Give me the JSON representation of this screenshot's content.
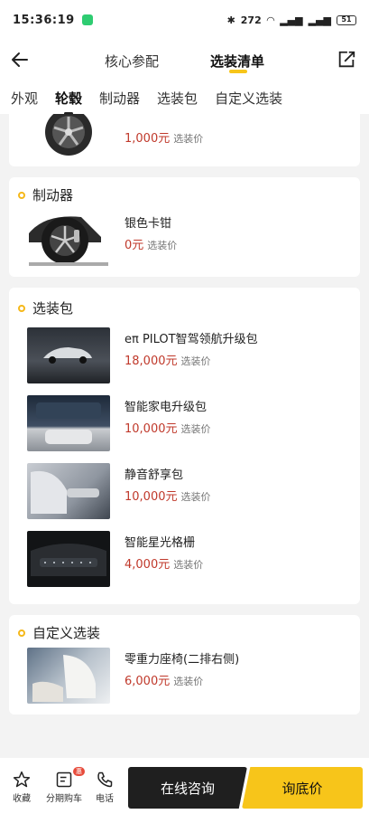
{
  "status_bar": {
    "time": "15:36:19",
    "network": "272",
    "battery": "51"
  },
  "header": {
    "tab_core": "核心参配",
    "tab_list": "选装清单"
  },
  "subtabs": [
    "外观",
    "轮毂",
    "制动器",
    "选装包",
    "自定义选装"
  ],
  "price_suffix": "选装价",
  "sections": {
    "wheels_partial": {
      "price": "1,000元"
    },
    "brakes": {
      "title": "制动器",
      "items": [
        {
          "name": "银色卡钳",
          "price": "0元"
        }
      ]
    },
    "packages": {
      "title": "选装包",
      "items": [
        {
          "name": "eπ PILOT智驾领航升级包",
          "price": "18,000元"
        },
        {
          "name": "智能家电升级包",
          "price": "10,000元"
        },
        {
          "name": "静音舒享包",
          "price": "10,000元"
        },
        {
          "name": "智能星光格栅",
          "price": "4,000元"
        }
      ]
    },
    "custom": {
      "title": "自定义选装",
      "items": [
        {
          "name": "零重力座椅(二排右侧)",
          "price": "6,000元"
        }
      ]
    }
  },
  "bottom_bar": {
    "favorite": "收藏",
    "installment": "分期购车",
    "installment_badge": "惠",
    "phone": "电话",
    "consult": "在线咨询",
    "ask_price": "询底价"
  }
}
